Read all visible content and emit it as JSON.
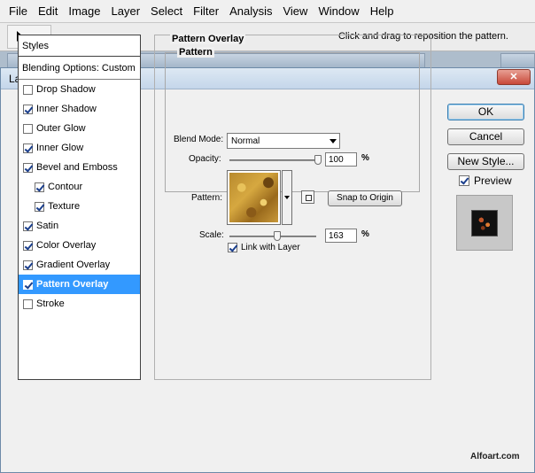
{
  "app": {
    "menu": [
      "File",
      "Edit",
      "Image",
      "Layer",
      "Select",
      "Filter",
      "Analysis",
      "View",
      "Window",
      "Help"
    ],
    "options_hint": "Click and drag to reposition the pattern."
  },
  "dialog": {
    "title": "Layer Style",
    "close_glyph": "✕",
    "styles_header": "Styles",
    "blending_options": "Blending Options: Custom",
    "style_items": [
      {
        "label": "Drop Shadow",
        "checked": false
      },
      {
        "label": "Inner Shadow",
        "checked": true
      },
      {
        "label": "Outer Glow",
        "checked": false
      },
      {
        "label": "Inner Glow",
        "checked": true
      },
      {
        "label": "Bevel and Emboss",
        "checked": true
      },
      {
        "label": "Contour",
        "checked": true,
        "sub": true
      },
      {
        "label": "Texture",
        "checked": true,
        "sub": true
      },
      {
        "label": "Satin",
        "checked": true
      },
      {
        "label": "Color Overlay",
        "checked": true
      },
      {
        "label": "Gradient Overlay",
        "checked": true
      },
      {
        "label": "Pattern Overlay",
        "checked": true,
        "selected": true
      },
      {
        "label": "Stroke",
        "checked": false
      }
    ],
    "panel": {
      "group_title": "Pattern Overlay",
      "section_title": "Pattern",
      "blend_mode_label": "Blend Mode:",
      "blend_mode_value": "Normal",
      "opacity_label": "Opacity:",
      "opacity_value": "100",
      "opacity_unit": "%",
      "opacity_fraction": 1.0,
      "pattern_label": "Pattern:",
      "snap_button": "Snap to Origin",
      "scale_label": "Scale:",
      "scale_value": "163",
      "scale_unit": "%",
      "link_label": "Link with Layer",
      "link_checked": true
    },
    "buttons": {
      "ok": "OK",
      "cancel": "Cancel",
      "new_style": "New Style..."
    },
    "preview_label": "Preview",
    "preview_checked": true
  },
  "watermark": "Alfoart.com"
}
